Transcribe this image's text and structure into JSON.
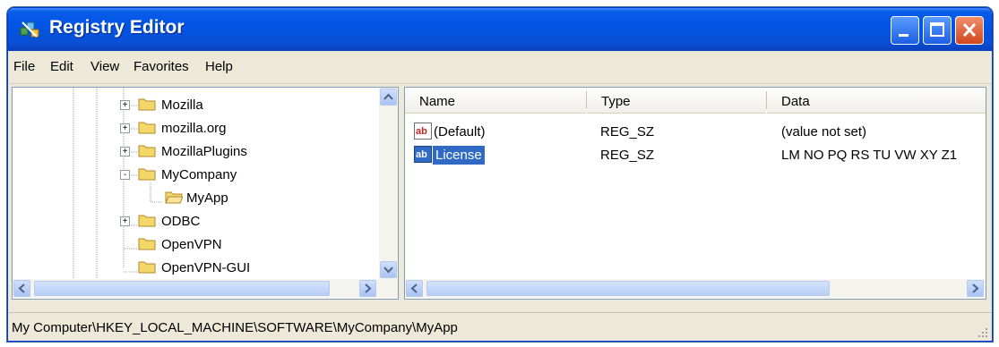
{
  "window": {
    "title": "Registry Editor",
    "icon": "registry-icon",
    "controls": [
      "minimize",
      "maximize",
      "close"
    ]
  },
  "menu": [
    "File",
    "Edit",
    "View",
    "Favorites",
    "Help"
  ],
  "tree": {
    "items": [
      {
        "label": "Mozilla",
        "expander": "+",
        "state": "closed"
      },
      {
        "label": "mozilla.org",
        "expander": "+",
        "state": "closed"
      },
      {
        "label": "MozillaPlugins",
        "expander": "+",
        "state": "closed"
      },
      {
        "label": "MyCompany",
        "expander": "-",
        "state": "open"
      },
      {
        "label": "MyApp",
        "expander": "",
        "state": "open-selected"
      },
      {
        "label": "ODBC",
        "expander": "+",
        "state": "closed"
      },
      {
        "label": "OpenVPN",
        "expander": "",
        "state": "closed"
      },
      {
        "label": "OpenVPN-GUI",
        "expander": "",
        "state": "closed"
      }
    ]
  },
  "list": {
    "columns": [
      "Name",
      "Type",
      "Data"
    ],
    "rows": [
      {
        "name": "(Default)",
        "type": "REG_SZ",
        "data": "(value not set)",
        "selected": false
      },
      {
        "name": "License",
        "type": "REG_SZ",
        "data": "LM NO PQ RS TU VW XY Z1",
        "selected": true
      }
    ]
  },
  "status": {
    "path": "My Computer\\HKEY_LOCAL_MACHINE\\SOFTWARE\\MyCompany\\MyApp"
  },
  "colors": {
    "titlebar": "#0055e5",
    "selection": "#316ac5",
    "folder": "#f5d66b"
  }
}
